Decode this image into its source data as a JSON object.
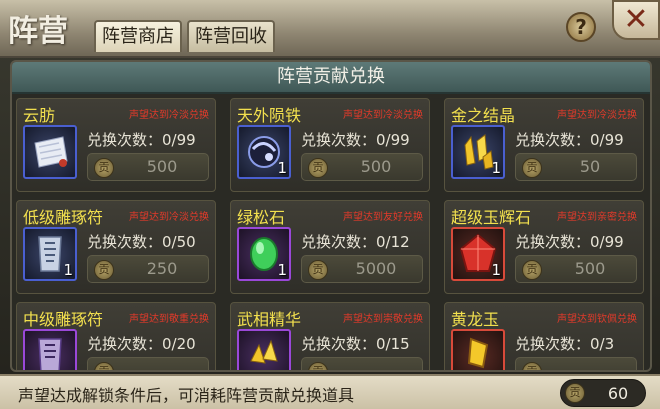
{
  "header": {
    "title": "阵营",
    "tabs": [
      {
        "label": "阵营商店",
        "active": true
      },
      {
        "label": "阵营回收",
        "active": false
      }
    ],
    "help_icon": "?",
    "close_icon": "✕"
  },
  "panel": {
    "title": "阵营贡献兑换",
    "items": [
      {
        "name": "云肪",
        "condition": "声望达到冷淡兑换",
        "exchange": "兑换次数：0/99",
        "price": "500",
        "count": "",
        "slot_color": "blue",
        "icon": "scroll-icon"
      },
      {
        "name": "天外陨铁",
        "condition": "声望达到冷淡兑换",
        "exchange": "兑换次数：0/99",
        "price": "500",
        "count": "1",
        "slot_color": "blue",
        "icon": "meteor-icon"
      },
      {
        "name": "金之结晶",
        "condition": "声望达到冷淡兑换",
        "exchange": "兑换次数：0/99",
        "price": "50",
        "count": "1",
        "slot_color": "blue",
        "icon": "gold-crystal-icon"
      },
      {
        "name": "低级雕琢符",
        "condition": "声望达到冷淡兑换",
        "exchange": "兑换次数：0/50",
        "price": "250",
        "count": "1",
        "slot_color": "blue",
        "icon": "talisman-icon"
      },
      {
        "name": "绿松石",
        "condition": "声望达到友好兑换",
        "exchange": "兑换次数：0/12",
        "price": "5000",
        "count": "1",
        "slot_color": "purple",
        "icon": "turquoise-icon"
      },
      {
        "name": "超级玉辉石",
        "condition": "声望达到亲密兑换",
        "exchange": "兑换次数：0/99",
        "price": "500",
        "count": "1",
        "slot_color": "red",
        "icon": "jade-stone-icon"
      },
      {
        "name": "中级雕琢符",
        "condition": "声望达到敬重兑换",
        "exchange": "兑换次数：0/20",
        "price": "",
        "count": "",
        "slot_color": "purple",
        "icon": "talisman-icon"
      },
      {
        "name": "武相精华",
        "condition": "声望达到崇敬兑换",
        "exchange": "兑换次数：0/15",
        "price": "",
        "count": "",
        "slot_color": "purple",
        "icon": "essence-icon"
      },
      {
        "name": "黄龙玉",
        "condition": "声望达到钦佩兑换",
        "exchange": "兑换次数：0/3",
        "price": "",
        "count": "",
        "slot_color": "red",
        "icon": "yellow-jade-icon"
      }
    ]
  },
  "footer": {
    "tip": "声望达成解锁条件后，可消耗阵营贡献兑换道具",
    "balance": "60"
  },
  "colors": {
    "item_name": "#f2e04e",
    "condition": "#e23a2a",
    "panel_header": "#4e6a68"
  }
}
